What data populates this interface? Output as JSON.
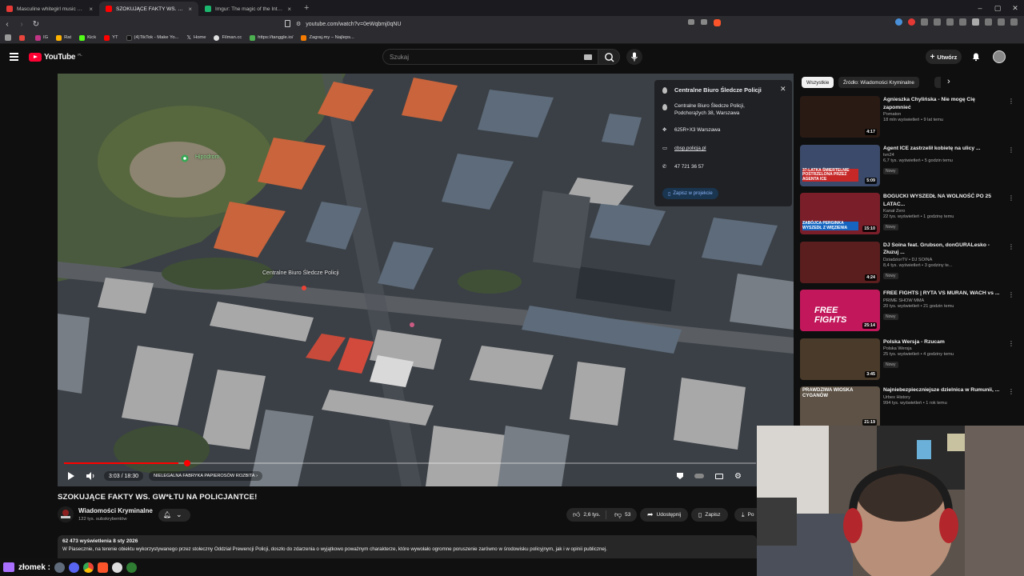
{
  "browser": {
    "tabs": [
      {
        "label": "Masculine whitegirl music playlis",
        "favicon_color": "#e53935",
        "active": false
      },
      {
        "label": "SZOKUJĄCE FAKTY WS. GW*Ł",
        "favicon_color": "#ff0000",
        "active": true
      },
      {
        "label": "Imgur: The magic of the Internet",
        "favicon_color": "#1bb76e",
        "active": false
      }
    ],
    "url": "youtube.com/watch?v=0eWqbmj0qNU",
    "bookmarks": [
      {
        "label": "",
        "color": "#e8453c"
      },
      {
        "label": "IG",
        "color": "#c13584"
      },
      {
        "label": "Rat",
        "color": "#ffb300"
      },
      {
        "label": "Kick",
        "color": "#53fc18"
      },
      {
        "label": "YT",
        "color": "#ff0000"
      },
      {
        "label": "(4)TikTok - Make Yo...",
        "color": "#111111"
      },
      {
        "label": "Home",
        "color": "#000000"
      },
      {
        "label": "Filman.cc",
        "color": "#e0e0e0"
      },
      {
        "label": "https://tanggle.io/",
        "color": "#4caf50"
      },
      {
        "label": "Zagraj.my – Najleps...",
        "color": "#f57c00"
      }
    ]
  },
  "header": {
    "logo_text": "YouTube",
    "country_code": "PL",
    "search_placeholder": "Szukaj",
    "create_label": "Utwórz"
  },
  "player": {
    "time": "3:03 / 18:30",
    "progress_fraction": 0.165,
    "chapter": "NIELEGALNA FABRYKA PAPIEROSÓW ROZBITA",
    "map_label_main": "Centralne Biuro Śledcze Policji",
    "map_label_park": "Hipodrom"
  },
  "infocard": {
    "title": "Centralne Biuro Śledcze Policji",
    "address": "Centralne Biuro Śledcze Policji, Podchorążych 38, Warszawa",
    "plus_code": "625R+X3 Warszawa",
    "website": "cbsp.policja.pl",
    "phone": "47 721 36 57",
    "save_label": "Zapisz w projekcie"
  },
  "video": {
    "title": "SZOKUJĄCE FAKTY WS. GW*ŁTU NA POLICJANTCE!",
    "channel": "Wiadomości Kryminalne",
    "subscribers": "122 tys. subskrybentów",
    "likes": "2,6 tys.",
    "dislikes": "53",
    "share_label": "Udostępnij",
    "save_label": "Zapisz",
    "download_label": "Po",
    "views_date": "62 473 wyświetlenia  8 sty 2026",
    "description": "W Piasecznie, na terenie obiektu wykorzystywanego przez stołeczny Oddział Prewencji Policji, doszło do zdarzenia o wyjątkowo poważnym charakterze, które wywołało ogromne poruszenie zarówno w środowisku policyjnym, jak i w opinii publicznej."
  },
  "sidebar": {
    "chips": [
      "Wszystkie",
      "Źródło: Wiadomości Kryminalne"
    ],
    "items": [
      {
        "title": "Agnieszka Chylińska - Nie mogę Cię zapomnieć",
        "channel": "Pomaton",
        "views": "18 mln wyświetleń • 9 lat temu",
        "duration": "4:17",
        "badge": "",
        "thumb": "#2a1a14"
      },
      {
        "title": "Agent ICE zastrzelił kobietę na ulicy ...",
        "channel": "tvn24",
        "views": "6,7 tys. wyświetleń • 5 godzin temu",
        "duration": "5:09",
        "badge": "Nowy",
        "thumb": "#3b4a6a"
      },
      {
        "title": "BOGUCKI WYSZEDŁ NA WOLNOŚĆ PO 25 LATAC...",
        "channel": "Kanał Zero",
        "views": "22 tys. wyświetleń • 1 godzinę temu",
        "duration": "15:10",
        "badge": "Nowy",
        "thumb": "#7a1f2a"
      },
      {
        "title": "DJ Soina feat. Grubson, donGURALesko - Złuzuj ...",
        "channel": "DziadziorTV • DJ SOINA",
        "views": "8,4 tys. wyświetleń • 3 godziny te...",
        "duration": "4:24",
        "badge": "Nowy",
        "thumb": "#5a1e1e"
      },
      {
        "title": "FREE FIGHTS | RYTA VS MURAN, WACH vs ...",
        "channel": "PRIME SHOW MMA",
        "views": "20 tys. wyświetleń • 21 godzin temu",
        "duration": "25:14",
        "badge": "Nowy",
        "thumb": "#c2185b"
      },
      {
        "title": "Polska Wersja - Rzucam",
        "channel": "Polska Wersja",
        "views": "25 tys. wyświetleń • 4 godziny temu",
        "duration": "3:45",
        "badge": "Nowy",
        "thumb": "#4a3a2a"
      },
      {
        "title": "Najniebezpieczniejsze dzielnica w Rumunii, ...",
        "channel": "Urbex History",
        "views": "994 tys. wyświetleń • 1 rok temu",
        "duration": "21:19",
        "badge": "",
        "thumb": "#5d5245"
      }
    ],
    "thumb_overlays": [
      "",
      "37-LATKA ŚMIERTELNIE POSTRZELONA PRZEZ AGENTA ICE",
      "ZABÓJCA PERGINKA WYSZEDŁ Z WIĘZIENIA",
      "",
      "FREE FIGHTS",
      "",
      "PRAWDZIWA WIOSKA CYGANÓW"
    ]
  },
  "taskbar": {
    "name": "złomek :"
  },
  "colors": {
    "accent_red": "#ff0000",
    "bg": "#0f0f0f",
    "pill": "#272727"
  }
}
